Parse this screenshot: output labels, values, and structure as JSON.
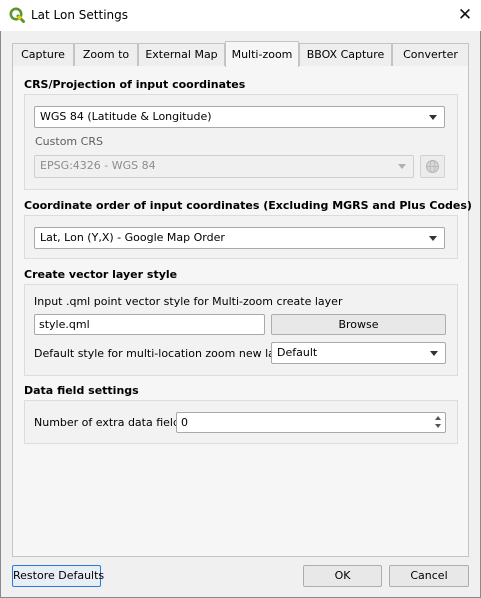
{
  "window": {
    "title": "Lat Lon Settings"
  },
  "tabs": [
    {
      "label": "Capture"
    },
    {
      "label": "Zoom to"
    },
    {
      "label": "External Map"
    },
    {
      "label": "Multi-zoom",
      "active": true
    },
    {
      "label": "BBOX Capture"
    },
    {
      "label": "Converter"
    }
  ],
  "crs_section": {
    "title": "CRS/Projection of input coordinates",
    "projection_value": "WGS 84 (Latitude & Longitude)",
    "custom_crs_label": "Custom CRS",
    "custom_crs_value": "EPSG:4326 - WGS 84"
  },
  "order_section": {
    "title": "Coordinate order of input coordinates (Excluding MGRS and Plus Codes)",
    "order_value": "Lat, Lon (Y,X) - Google Map Order"
  },
  "style_section": {
    "title": "Create vector layer style",
    "qml_label": "Input .qml point vector style for Multi-zoom create layer",
    "qml_value": "style.qml",
    "browse_label": "Browse",
    "default_style_label": "Default style for multi-location zoom new layers",
    "default_style_value": "Default"
  },
  "data_section": {
    "title": "Data field settings",
    "extra_fields_label": "Number of extra data fields",
    "extra_fields_value": "0"
  },
  "buttons": {
    "restore_defaults": "Restore Defaults",
    "ok": "OK",
    "cancel": "Cancel"
  },
  "colors": {
    "qgis_green": "#589632",
    "qgis_yellow": "#ee7913",
    "focus_blue": "#2a7ad5"
  }
}
